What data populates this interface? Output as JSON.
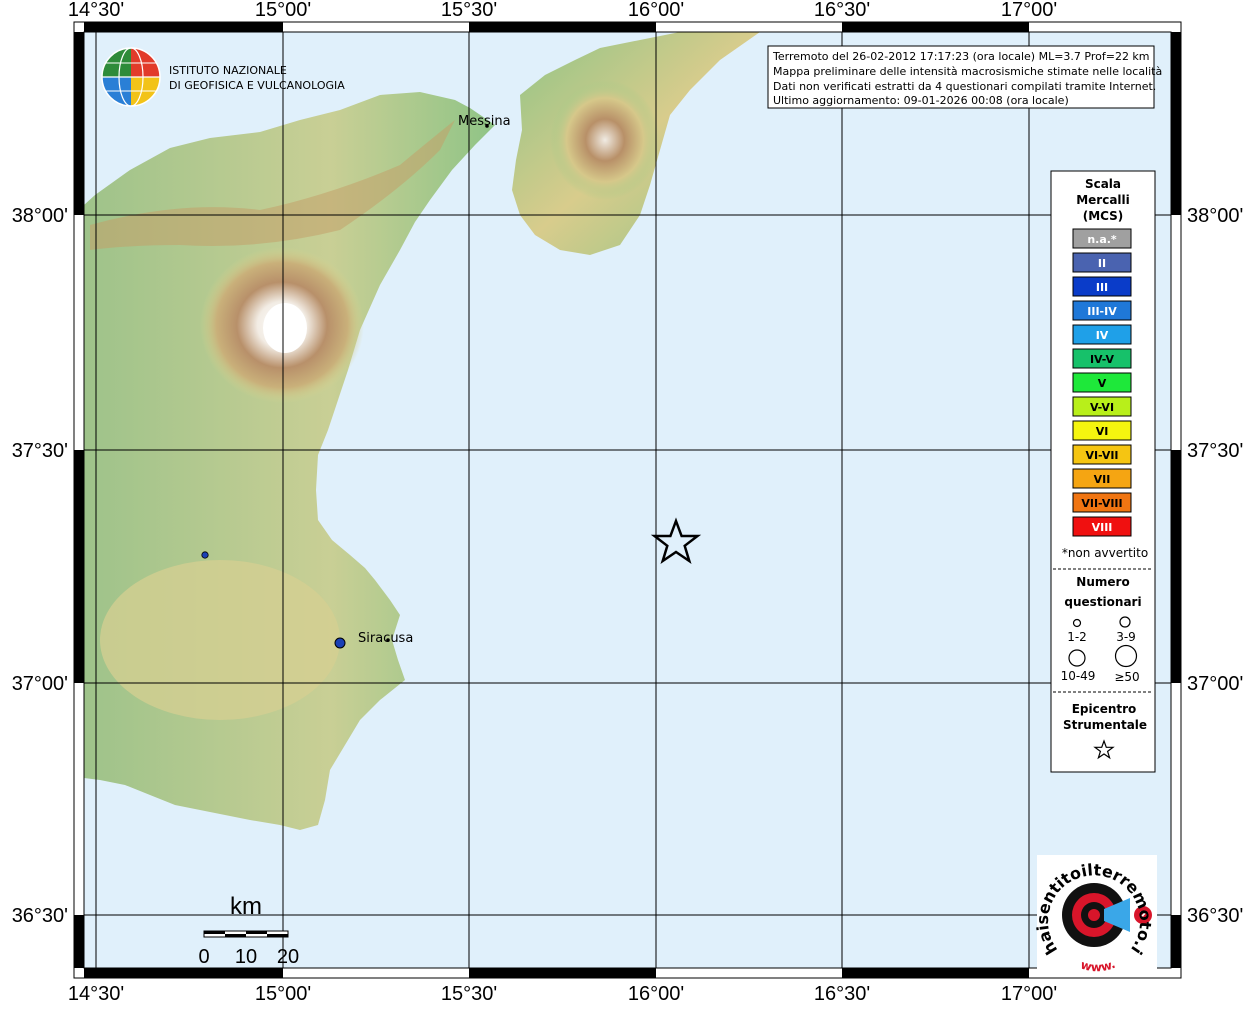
{
  "map": {
    "lon_ticks": [
      "14°30'",
      "15°00'",
      "15°30'",
      "16°00'",
      "16°30'",
      "17°00'"
    ],
    "lat_ticks": [
      "38°00'",
      "37°30'",
      "37°00'",
      "36°30'"
    ],
    "colors": {
      "sea": "#e0f0fb",
      "land_low": "#7fbf7b",
      "land_mid": "#d9d48f",
      "land_high": "#b08a5a",
      "summit": "#ffffff",
      "grid": "#000000",
      "observation": "#1a3fb5"
    }
  },
  "logo": {
    "line1": "ISTITUTO NAZIONALE",
    "line2": "DI GEOFISICA E VULCANOLOGIA"
  },
  "info_box": {
    "line1": "Terremoto del 26-02-2012 17:17:23 (ora locale) ML=3.7 Prof=22 km",
    "line2": "Mappa preliminare delle intensità macrosismiche stimate nelle località",
    "line3": "Dati non verificati estratti da 4 questionari compilati tramite Internet.",
    "line4": "Ultimo aggiornamento: 09-01-2026 00:08 (ora locale)"
  },
  "cities": [
    {
      "name": "Messina"
    },
    {
      "name": "Siracusa"
    }
  ],
  "observations": [
    {
      "place": "Siracusa",
      "questionnaires": "1-2"
    },
    {
      "place": "inland",
      "questionnaires": "1-2"
    }
  ],
  "epicenter": {
    "symbol": "star"
  },
  "legend": {
    "title1": "Scala",
    "title2": "Mercalli",
    "title3": "(MCS)",
    "classes": [
      {
        "label": "n.a.*",
        "color": "#a0a0a0",
        "dark_text": false
      },
      {
        "label": "II",
        "color": "#4a63b0",
        "dark_text": false
      },
      {
        "label": "III",
        "color": "#0a3cc9",
        "dark_text": false
      },
      {
        "label": "III-IV",
        "color": "#1f78d8",
        "dark_text": false
      },
      {
        "label": "IV",
        "color": "#1fa0e8",
        "dark_text": false
      },
      {
        "label": "IV-V",
        "color": "#17c16a",
        "dark_text": true
      },
      {
        "label": "V",
        "color": "#1ee83a",
        "dark_text": true
      },
      {
        "label": "V-VI",
        "color": "#b8ef1a",
        "dark_text": true
      },
      {
        "label": "VI",
        "color": "#f5f50f",
        "dark_text": true
      },
      {
        "label": "VI-VII",
        "color": "#f5c512",
        "dark_text": true
      },
      {
        "label": "VII",
        "color": "#f5a512",
        "dark_text": true
      },
      {
        "label": "VII-VIII",
        "color": "#f07512",
        "dark_text": true
      },
      {
        "label": "VIII",
        "color": "#f01010",
        "dark_text": false
      }
    ],
    "note": "*non avvertito",
    "count_title1": "Numero",
    "count_title2": "questionari",
    "count_sizes": [
      "1-2",
      "3-9",
      "10-49",
      "≥50"
    ],
    "epi_title1": "Epicentro",
    "epi_title2": "Strumentale"
  },
  "scale_bar": {
    "unit": "km",
    "labels": [
      "0",
      "10",
      "20"
    ]
  },
  "badge": {
    "text": "haisentitoilterremoto.it",
    "prefix": "www."
  }
}
